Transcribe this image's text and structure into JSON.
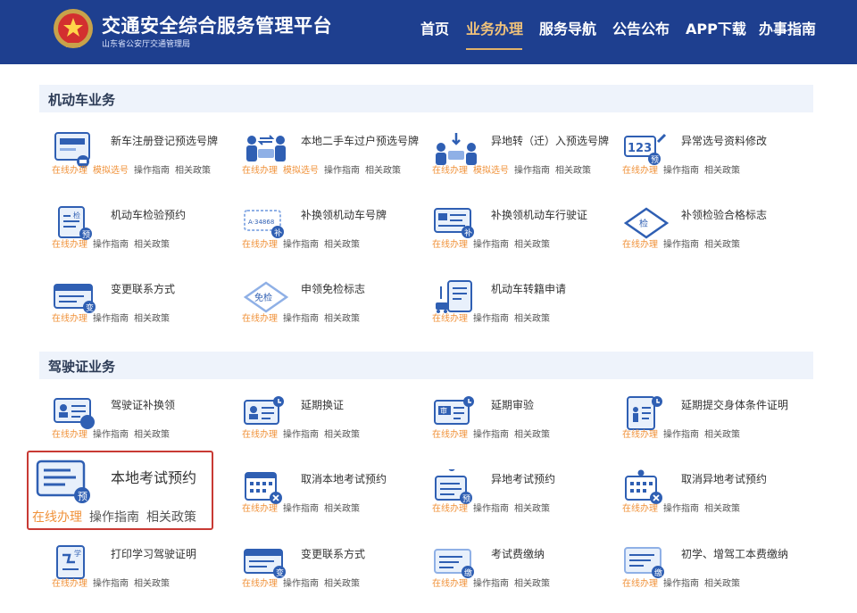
{
  "header": {
    "title": "交通安全综合服务管理平台",
    "subtitle": "山东省公安厅交通管理局",
    "nav": [
      "首页",
      "业务办理",
      "服务导航",
      "公告公布",
      "APP下载",
      "办事指南"
    ],
    "active_nav": "业务办理"
  },
  "colors": {
    "header_bg": "#1e3f8f",
    "accent_orange": "#f0923a",
    "highlight_border": "#c83a34",
    "section_bg": "#eef3fb"
  },
  "motor": {
    "title": "机动车业务",
    "items": [
      {
        "title": "新车注册登记预选号牌",
        "icon": "new-car-plate-icon",
        "links": [
          "在线办理",
          "模拟选号",
          "操作指南",
          "相关政策"
        ]
      },
      {
        "title": "本地二手车过户预选号牌",
        "icon": "used-car-transfer-icon",
        "links": [
          "在线办理",
          "模拟选号",
          "操作指南",
          "相关政策"
        ]
      },
      {
        "title": "异地转（迁）入预选号牌",
        "icon": "car-transfer-in-icon",
        "links": [
          "在线办理",
          "模拟选号",
          "操作指南",
          "相关政策"
        ]
      },
      {
        "title": "异常选号资料修改",
        "icon": "plate-123-edit-icon",
        "links": [
          "在线办理",
          "操作指南",
          "相关政策"
        ]
      },
      {
        "title": "机动车检验预约",
        "icon": "inspection-appointment-icon",
        "links": [
          "在线办理",
          "操作指南",
          "相关政策"
        ]
      },
      {
        "title": "补换领机动车号牌",
        "icon": "replace-plate-icon",
        "links": [
          "在线办理",
          "操作指南",
          "相关政策"
        ]
      },
      {
        "title": "补换领机动车行驶证",
        "icon": "replace-license-card-icon",
        "links": [
          "在线办理",
          "操作指南",
          "相关政策"
        ]
      },
      {
        "title": "补领检验合格标志",
        "icon": "inspection-mark-icon",
        "links": [
          "在线办理",
          "操作指南",
          "相关政策"
        ]
      },
      {
        "title": "变更联系方式",
        "icon": "contact-change-icon",
        "links": [
          "在线办理",
          "操作指南",
          "相关政策"
        ]
      },
      {
        "title": "申领免检标志",
        "icon": "exemption-mark-icon",
        "links": [
          "在线办理",
          "操作指南",
          "相关政策"
        ]
      },
      {
        "title": "机动车转籍申请",
        "icon": "car-registry-transfer-icon",
        "links": [
          "在线办理",
          "操作指南",
          "相关政策"
        ]
      }
    ]
  },
  "driver": {
    "title": "驾驶证业务",
    "items": [
      {
        "title": "驾驶证补换领",
        "icon": "license-replace-icon",
        "links": [
          "在线办理",
          "操作指南",
          "相关政策"
        ]
      },
      {
        "title": "延期换证",
        "icon": "extend-renewal-icon",
        "links": [
          "在线办理",
          "操作指南",
          "相关政策"
        ]
      },
      {
        "title": "延期审验",
        "icon": "extend-review-icon",
        "links": [
          "在线办理",
          "操作指南",
          "相关政策"
        ]
      },
      {
        "title": "延期提交身体条件证明",
        "icon": "health-certificate-icon",
        "links": [
          "在线办理",
          "操作指南",
          "相关政策"
        ]
      },
      {
        "title": "本地考试预约",
        "icon": "local-exam-booking-icon",
        "links": [
          "在线办理",
          "操作指南",
          "相关政策"
        ]
      },
      {
        "title": "取消本地考试预约",
        "icon": "cancel-local-exam-icon",
        "links": [
          "在线办理",
          "操作指南",
          "相关政策"
        ]
      },
      {
        "title": "异地考试预约",
        "icon": "remote-exam-booking-icon",
        "links": [
          "在线办理",
          "操作指南",
          "相关政策"
        ]
      },
      {
        "title": "取消异地考试预约",
        "icon": "cancel-remote-exam-icon",
        "links": [
          "在线办理",
          "操作指南",
          "相关政策"
        ]
      },
      {
        "title": "打印学习驾驶证明",
        "icon": "print-learner-permit-icon",
        "links": [
          "在线办理",
          "操作指南",
          "相关政策"
        ]
      },
      {
        "title": "变更联系方式",
        "icon": "contact-change-icon",
        "links": [
          "在线办理",
          "操作指南",
          "相关政策"
        ]
      },
      {
        "title": "考试费缴纳",
        "icon": "exam-fee-icon",
        "links": [
          "在线办理",
          "操作指南",
          "相关政策"
        ]
      },
      {
        "title": "初学、增驾工本费缴纳",
        "icon": "license-fee-icon",
        "links": [
          "在线办理",
          "操作指南",
          "相关政策"
        ]
      }
    ]
  },
  "badges": {
    "yu": "预",
    "bu": "补",
    "bian": "变",
    "jian": "检",
    "mianjian": "免检",
    "xue": "学",
    "jiao": "缴",
    "shen": "审",
    "plate_num": "123",
    "plate_text": "A·34868"
  }
}
